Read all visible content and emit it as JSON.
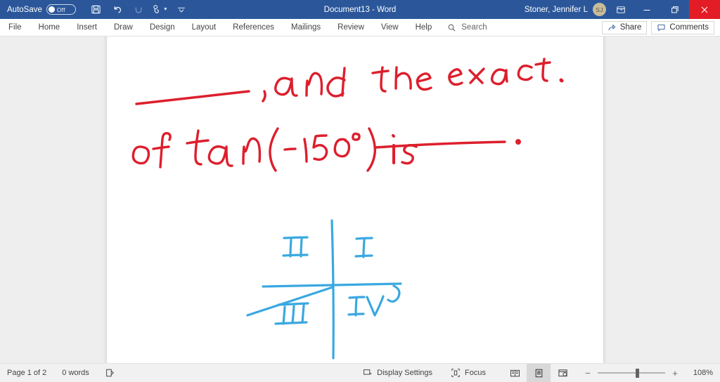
{
  "titlebar": {
    "autosave_label": "AutoSave",
    "autosave_state": "Off",
    "document_title": "Document13  -  Word",
    "account_name": "Stoner, Jennifer L",
    "account_initials": "SJ",
    "quick_access": [
      {
        "name": "save-button",
        "icon": "save-icon"
      },
      {
        "name": "undo-button",
        "icon": "undo-icon"
      },
      {
        "name": "redo-button",
        "icon": "redo-icon"
      },
      {
        "name": "touch-mode-button",
        "icon": "touch-pen-icon"
      },
      {
        "name": "customize-quick-access-button",
        "icon": "chevron-down-icon"
      }
    ],
    "window_buttons": {
      "ribbon_display_options": "ribbon-display-options-icon",
      "minimize": "minimize-icon",
      "restore": "restore-icon",
      "close": "close-icon"
    },
    "colors": {
      "titlebar_bg": "#2b579a",
      "close_bg": "#e31c25",
      "avatar_bg": "#c8bc9b"
    }
  },
  "ribbon": {
    "tabs": [
      {
        "label": "File",
        "active": false
      },
      {
        "label": "Home",
        "active": false
      },
      {
        "label": "Insert",
        "active": false
      },
      {
        "label": "Draw",
        "active": false
      },
      {
        "label": "Design",
        "active": false
      },
      {
        "label": "Layout",
        "active": false
      },
      {
        "label": "References",
        "active": false
      },
      {
        "label": "Mailings",
        "active": false
      },
      {
        "label": "Review",
        "active": false
      },
      {
        "label": "View",
        "active": false
      },
      {
        "label": "Help",
        "active": false
      }
    ],
    "search_placeholder": "Search",
    "share_label": "Share",
    "comments_label": "Comments"
  },
  "document": {
    "ink_color_red": "#dd1f2d",
    "ink_color_blue": "#3aa8e0",
    "handwriting": {
      "line1": ", and the exact",
      "line2": "of tan(-150°) is",
      "blank1": "_________",
      "blank2": "_________"
    },
    "diagram": {
      "name": "coordinate-plane-quadrants",
      "quadrant_labels": [
        "I",
        "II",
        "III",
        "IV"
      ],
      "has_terminal_ray": true,
      "has_angle_arc": true
    }
  },
  "statusbar": {
    "page_label": "Page 1 of 2",
    "word_count": "0 words",
    "proofing_icon": "proofing-errors-icon",
    "display_settings_label": "Display Settings",
    "focus_label": "Focus",
    "view_modes": [
      {
        "name": "read-mode-button",
        "selected": false
      },
      {
        "name": "print-layout-button",
        "selected": true
      },
      {
        "name": "web-layout-button",
        "selected": false
      }
    ],
    "zoom_out": "−",
    "zoom_in": "+",
    "zoom_level": "108%"
  }
}
